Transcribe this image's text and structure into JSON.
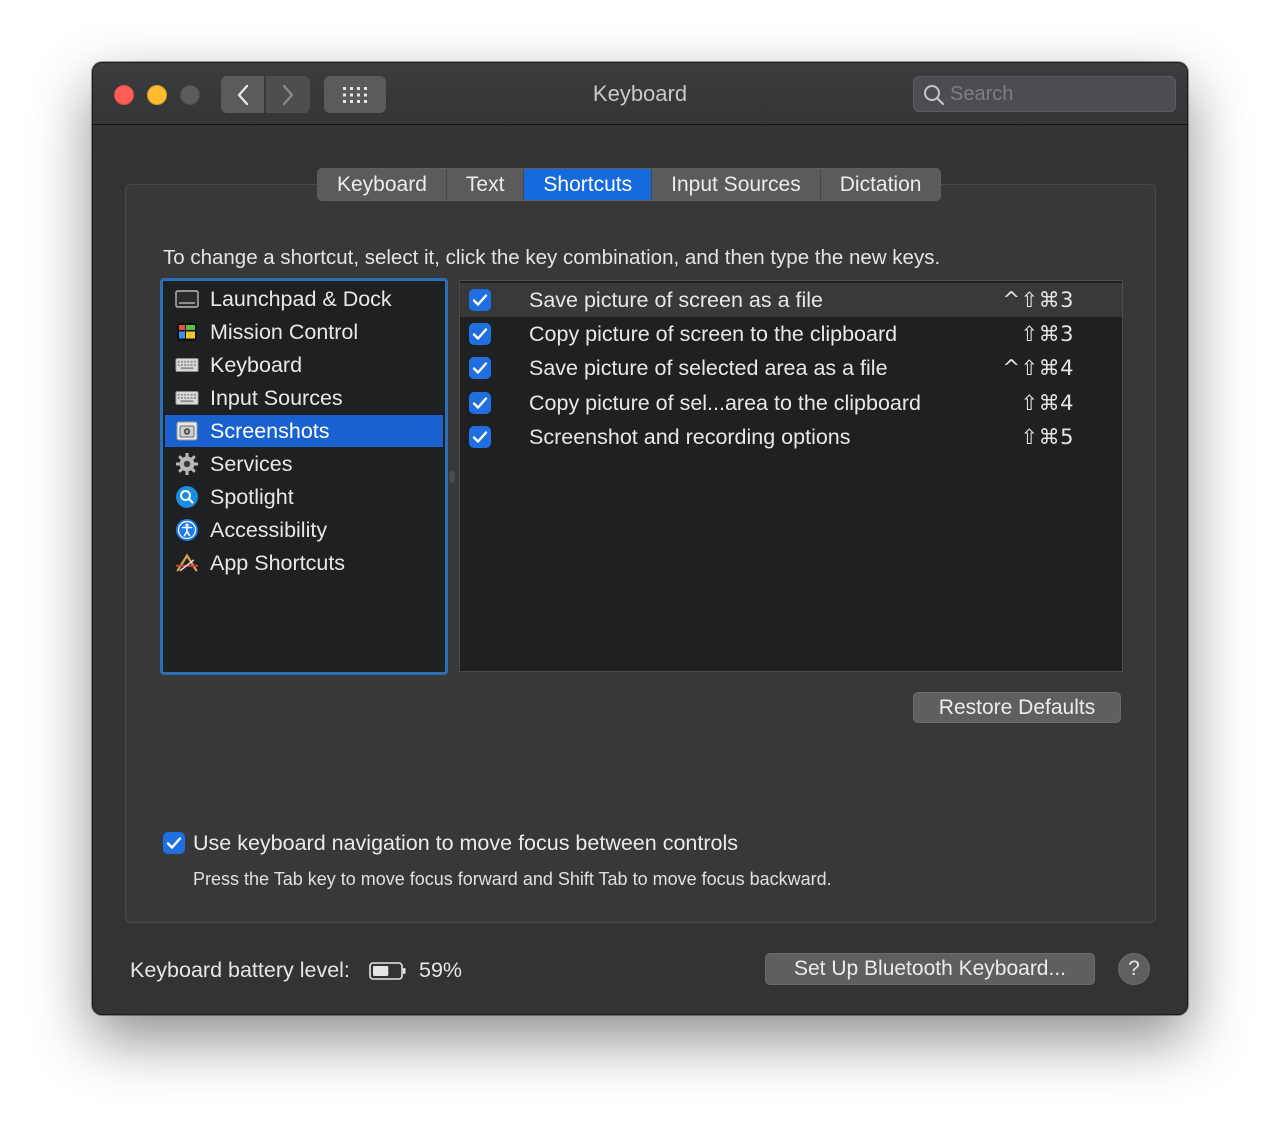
{
  "window": {
    "title": "Keyboard",
    "search_placeholder": "Search"
  },
  "tabs": [
    {
      "label": "Keyboard",
      "active": false
    },
    {
      "label": "Text",
      "active": false
    },
    {
      "label": "Shortcuts",
      "active": true
    },
    {
      "label": "Input Sources",
      "active": false
    },
    {
      "label": "Dictation",
      "active": false
    }
  ],
  "instructions": "To change a shortcut, select it, click the key combination, and then type the new keys.",
  "categories": [
    {
      "label": "Launchpad & Dock",
      "icon": "launchpad-icon",
      "selected": false
    },
    {
      "label": "Mission Control",
      "icon": "mission-control-icon",
      "selected": false
    },
    {
      "label": "Keyboard",
      "icon": "keyboard-icon",
      "selected": false
    },
    {
      "label": "Input Sources",
      "icon": "input-sources-icon",
      "selected": false
    },
    {
      "label": "Screenshots",
      "icon": "screenshot-icon",
      "selected": true
    },
    {
      "label": "Services",
      "icon": "gear-icon",
      "selected": false
    },
    {
      "label": "Spotlight",
      "icon": "spotlight-icon",
      "selected": false
    },
    {
      "label": "Accessibility",
      "icon": "accessibility-icon",
      "selected": false
    },
    {
      "label": "App Shortcuts",
      "icon": "app-store-icon",
      "selected": false
    }
  ],
  "shortcuts": [
    {
      "checked": true,
      "label": "Save picture of screen as a file",
      "keys": "^⇧⌘3"
    },
    {
      "checked": true,
      "label": "Copy picture of screen to the clipboard",
      "keys": "⇧⌘3"
    },
    {
      "checked": true,
      "label": "Save picture of selected area as a file",
      "keys": "^⇧⌘4"
    },
    {
      "checked": true,
      "label": "Copy picture of sel...area to the clipboard",
      "keys": "⇧⌘4"
    },
    {
      "checked": true,
      "label": "Screenshot and recording options",
      "keys": "⇧⌘5"
    }
  ],
  "restore_defaults": "Restore Defaults",
  "keyboard_navigation": {
    "checked": true,
    "label": "Use keyboard navigation to move focus between controls",
    "hint": "Press the Tab key to move focus forward and Shift Tab to move focus backward."
  },
  "battery": {
    "label": "Keyboard battery level:",
    "percent": "59%",
    "level": 0.59
  },
  "bluetooth_button": "Set Up Bluetooth Keyboard...",
  "help_label": "?",
  "colors": {
    "accent": "#1769de",
    "selection": "#1861cf",
    "checkbox": "#1f6fe0",
    "window_bg": "#323335",
    "close": "#fd5f58",
    "minimize": "#fdbd2e"
  }
}
